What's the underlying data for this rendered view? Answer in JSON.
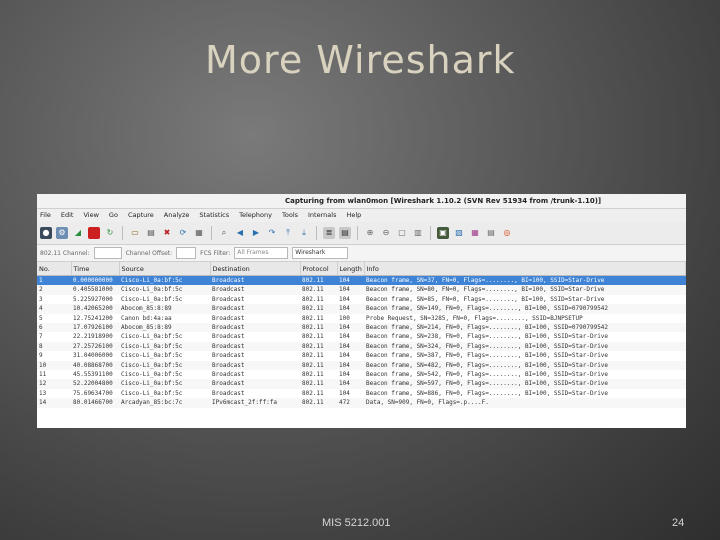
{
  "slide": {
    "title": "More Wireshark",
    "footer": "MIS 5212.001",
    "page_number": "24"
  },
  "window": {
    "title": "Capturing from wlan0mon   [Wireshark 1.10.2  (SVN Rev 51934 from /trunk-1.10)]"
  },
  "menu": [
    "File",
    "Edit",
    "View",
    "Go",
    "Capture",
    "Analyze",
    "Statistics",
    "Telephony",
    "Tools",
    "Internals",
    "Help"
  ],
  "filterbar": {
    "channel_label": "802.11 Channel:",
    "offset_label": "Channel Offset:",
    "fcs_label": "FCS Filter:",
    "fcs_value": "All Frames",
    "decrypt_value": "Wireshark"
  },
  "columns": [
    "No.",
    "Time",
    "Source",
    "Destination",
    "Protocol",
    "Length",
    "Info"
  ],
  "packets": [
    {
      "no": "1",
      "time": "0.000000000",
      "src": "Cisco-Li_0a:bf:5c",
      "dst": "Broadcast",
      "proto": "802.11",
      "len": "104",
      "info": "Beacon frame, SN=37, FN=0, Flags=........, BI=100, SSID=Star-Drive"
    },
    {
      "no": "2",
      "time": "0.405581000",
      "src": "Cisco-Li_0a:bf:5c",
      "dst": "Broadcast",
      "proto": "802.11",
      "len": "104",
      "info": "Beacon frame, SN=80, FN=0, Flags=........, BI=100, SSID=Star-Drive"
    },
    {
      "no": "3",
      "time": "5.225927000",
      "src": "Cisco-Li_0a:bf:5c",
      "dst": "Broadcast",
      "proto": "802.11",
      "len": "104",
      "info": "Beacon frame, SN=85, FN=0, Flags=........, BI=100, SSID=Star-Drive"
    },
    {
      "no": "4",
      "time": "10.42065200",
      "src": "Abocom_85:8:89",
      "dst": "Broadcast",
      "proto": "802.11",
      "len": "104",
      "info": "Beacon frame, SN=149, FN=0, Flags=........, BI=100, SSID=0790799542"
    },
    {
      "no": "5",
      "time": "12.75241200",
      "src": "Canon bd:4a:aa",
      "dst": "Broadcast",
      "proto": "802.11",
      "len": "100",
      "info": "Probe Request, SN=3285, FN=0, Flags=........, SSID=BJNPSETUP"
    },
    {
      "no": "6",
      "time": "17.07926100",
      "src": "Abocom_85:8:89",
      "dst": "Broadcast",
      "proto": "802.11",
      "len": "104",
      "info": "Beacon frame, SN=214, FN=0, Flags=........, BI=100, SSID=0790799542"
    },
    {
      "no": "7",
      "time": "22.21918900",
      "src": "Cisco-Li_0a:bf:5c",
      "dst": "Broadcast",
      "proto": "802.11",
      "len": "104",
      "info": "Beacon frame, SN=238, FN=0, Flags=........, BI=100, SSID=Star-Drive"
    },
    {
      "no": "8",
      "time": "27.25726100",
      "src": "Cisco-Li_0a:bf:5c",
      "dst": "Broadcast",
      "proto": "802.11",
      "len": "104",
      "info": "Beacon frame, SN=324, FN=0, Flags=........, BI=100, SSID=Star-Drive"
    },
    {
      "no": "9",
      "time": "31.04006000",
      "src": "Cisco-Li_0a:bf:5c",
      "dst": "Broadcast",
      "proto": "802.11",
      "len": "104",
      "info": "Beacon frame, SN=387, FN=0, Flags=........, BI=100, SSID=Star-Drive"
    },
    {
      "no": "10",
      "time": "40.08868700",
      "src": "Cisco-Li_0a:bf:5c",
      "dst": "Broadcast",
      "proto": "802.11",
      "len": "104",
      "info": "Beacon frame, SN=482, FN=0, Flags=........, BI=100, SSID=Star-Drive"
    },
    {
      "no": "11",
      "time": "45.55391100",
      "src": "Cisco-Li_0a:bf:5c",
      "dst": "Broadcast",
      "proto": "802.11",
      "len": "104",
      "info": "Beacon frame, SN=542, FN=0, Flags=........, BI=100, SSID=Star-Drive"
    },
    {
      "no": "12",
      "time": "52.22004800",
      "src": "Cisco-Li_0a:bf:5c",
      "dst": "Broadcast",
      "proto": "802.11",
      "len": "104",
      "info": "Beacon frame, SN=597, FN=0, Flags=........, BI=100, SSID=Star-Drive"
    },
    {
      "no": "13",
      "time": "75.69634700",
      "src": "Cisco-Li_0a:bf:5c",
      "dst": "Broadcast",
      "proto": "802.11",
      "len": "104",
      "info": "Beacon frame, SN=886, FN=0, Flags=........, BI=100, SSID=Star-Drive"
    },
    {
      "no": "14",
      "time": "80.01466700",
      "src": "Arcadyan_85:bc:7c",
      "dst": "IPv6mcast_2f:ff:fa",
      "proto": "802.11",
      "len": "472",
      "info": "Data, SN=909, FN=0, Flags=.p....F."
    }
  ],
  "selected_row": 0,
  "colors": {
    "selection": "#3e83d6",
    "capture_stop": "#cc1f1f"
  },
  "toolbar_icons": [
    "interface-icon",
    "options-icon",
    "start-capture-icon",
    "stop-capture-icon",
    "restart-capture-icon",
    "open-file-icon",
    "save-file-icon",
    "close-file-icon",
    "reload-icon",
    "print-icon",
    "find-icon",
    "back-icon",
    "forward-icon",
    "goto-icon",
    "first-packet-icon",
    "last-packet-icon",
    "autoscroll-icon",
    "colorize-icon",
    "zoom-in-icon",
    "zoom-out-icon",
    "normal-size-icon",
    "resize-columns-icon",
    "capture-filters-icon",
    "display-filters-icon",
    "coloring-rules-icon",
    "preferences-icon",
    "help-icon"
  ]
}
